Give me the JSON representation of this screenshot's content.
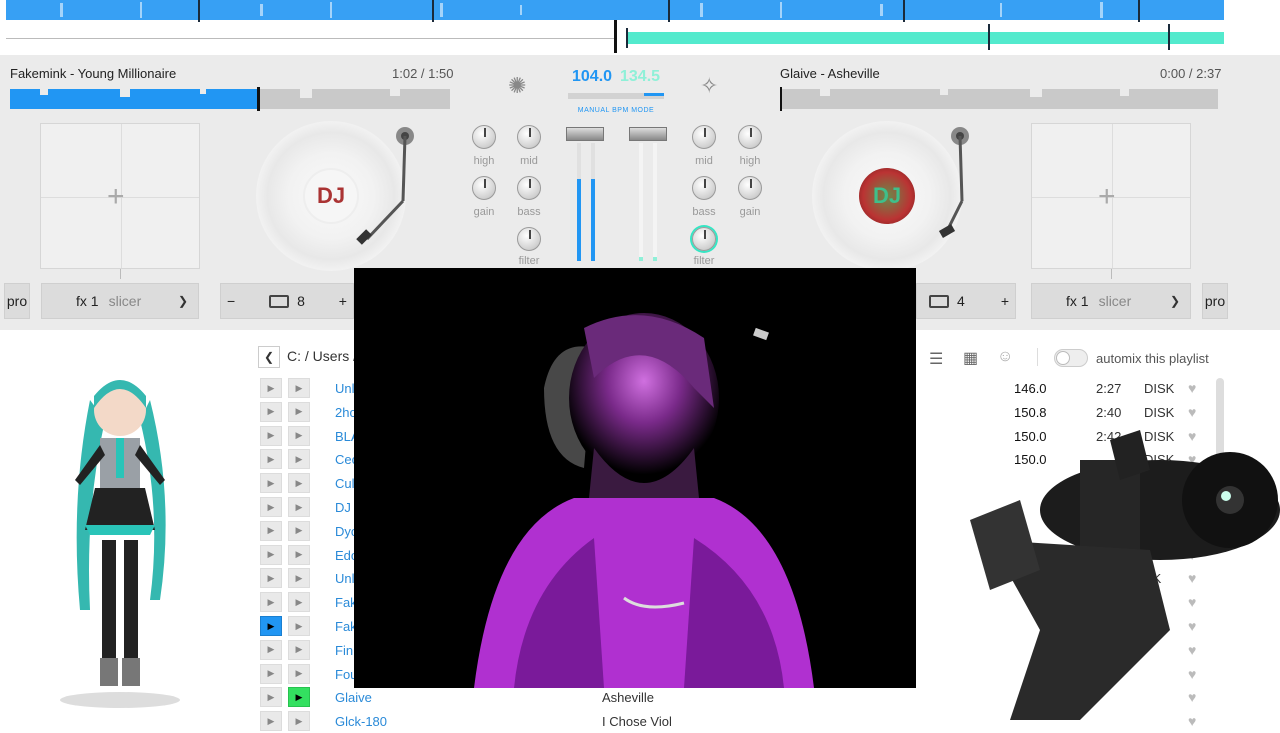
{
  "overview": {
    "accent_blue": "#2196f3",
    "accent_cyan": "#35e6c4"
  },
  "deck_left": {
    "title": "Fakemink - Young Millionaire",
    "time": "1:02 / 1:50",
    "progress": 0.56,
    "label_text": "DJ",
    "loop_value": "8",
    "fx_name": "fx 1",
    "fx_mode": "slicer",
    "pro_label": "pro",
    "minus_label": "−",
    "plus_label": "+"
  },
  "deck_right": {
    "title": "Glaive - Asheville",
    "time": "0:00 / 2:37",
    "progress": 0.0,
    "label_text": "DJ",
    "loop_value": "4",
    "fx_name": "fx 1",
    "fx_mode": "slicer",
    "pro_label": "pro",
    "plus_label": "+"
  },
  "mixer": {
    "bpm_left": "104.0",
    "bpm_right": "134.5",
    "bpm_mode": "MANUAL BPM MODE",
    "knob_labels_left": [
      "high",
      "mid",
      "gain",
      "bass",
      "filter"
    ],
    "knob_labels_right": [
      "mid",
      "high",
      "bass",
      "gain",
      "filter"
    ]
  },
  "browser": {
    "path": "C: / Users /",
    "automix_label": "automix this playlist",
    "tracks": [
      {
        "name": "Unl",
        "bpm": "146.0",
        "time": "2:27",
        "source": "DISK"
      },
      {
        "name": "2ho",
        "bpm": "150.8",
        "time": "2:40",
        "source": "DISK"
      },
      {
        "name": "BLA",
        "bpm": "150.0",
        "time": "2:42",
        "source": "DISK"
      },
      {
        "name": "Cec",
        "bpm": "150.0",
        "time": "",
        "source": "DISK"
      },
      {
        "name": "Cul",
        "bpm": "",
        "time": "",
        "source": ""
      },
      {
        "name": "DJ",
        "bpm": "",
        "time": "",
        "source": ""
      },
      {
        "name": "Dyo",
        "bpm": "",
        "time": "",
        "source": ""
      },
      {
        "name": "Edo",
        "bpm": "",
        "time": "",
        "source": ""
      },
      {
        "name": "Unl",
        "bpm": "",
        "time": "",
        "source": "SK"
      },
      {
        "name": "Fak",
        "bpm": "",
        "time": "",
        "source": ""
      },
      {
        "name": "Fak",
        "bpm": "",
        "time": "",
        "source": ""
      },
      {
        "name": "Fin",
        "bpm": "",
        "time": "",
        "source": ""
      },
      {
        "name": "Fou",
        "bpm": "",
        "time": "",
        "source": ""
      },
      {
        "name": "Glaive",
        "bpm": "",
        "time": "",
        "source": ""
      },
      {
        "name": "Glck-180",
        "bpm": "",
        "time": "",
        "source": ""
      }
    ],
    "glaive_album": "Asheville",
    "partial_next_album": "I Chose Viol"
  }
}
